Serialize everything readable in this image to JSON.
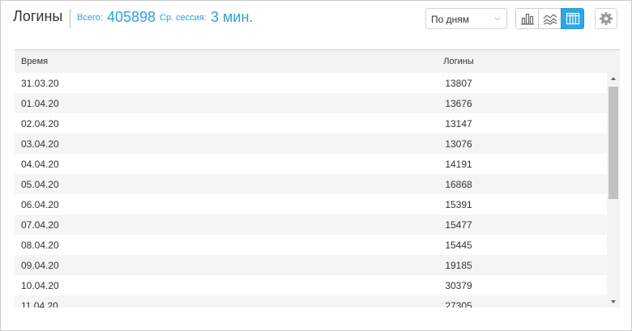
{
  "header": {
    "title": "Логины",
    "total_label": "Всего:",
    "total_value": "405898",
    "session_label": "Ср. сессия:",
    "session_value": "3 мин."
  },
  "controls": {
    "period_select": "По дням",
    "view_buttons": [
      "bar-chart-icon",
      "line-chart-icon",
      "table-icon"
    ],
    "active_view": "table-icon",
    "settings_icon": "gear-icon",
    "accent_color": "#2fa4e7"
  },
  "table": {
    "columns": [
      "Время",
      "Логины"
    ],
    "rows": [
      {
        "time": "31.03.20",
        "logins": "13807"
      },
      {
        "time": "01.04.20",
        "logins": "13676"
      },
      {
        "time": "02.04.20",
        "logins": "13147"
      },
      {
        "time": "03.04.20",
        "logins": "13076"
      },
      {
        "time": "04.04.20",
        "logins": "14191"
      },
      {
        "time": "05.04.20",
        "logins": "16868"
      },
      {
        "time": "06.04.20",
        "logins": "15391"
      },
      {
        "time": "07.04.20",
        "logins": "15477"
      },
      {
        "time": "08.04.20",
        "logins": "15445"
      },
      {
        "time": "09.04.20",
        "logins": "19185"
      },
      {
        "time": "10.04.20",
        "logins": "30379"
      },
      {
        "time": "11.04.20",
        "logins": "27305"
      }
    ]
  }
}
